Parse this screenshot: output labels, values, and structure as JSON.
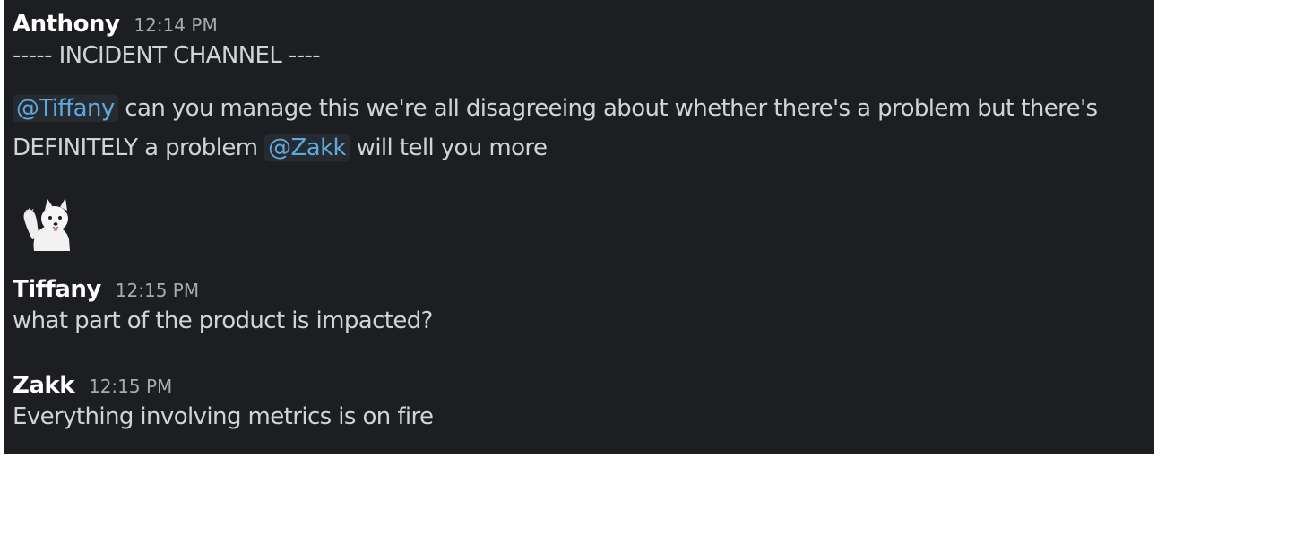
{
  "messages": [
    {
      "author": "Anthony",
      "time": "12:14 PM",
      "banner": "----- INCIDENT CHANNEL ----",
      "mention_1": "@Tiffany",
      "text_1": " can you manage this we're all disagreeing about whether there's a problem but there's",
      "text_2": "DEFINITELY a problem ",
      "mention_2": "@Zakk",
      "text_3": " will tell you more",
      "sticker": "waving-samoyed-icon"
    },
    {
      "author": "Tiffany",
      "time": "12:15 PM",
      "text": "what part of the product is impacted?"
    },
    {
      "author": "Zakk",
      "time": "12:15 PM",
      "text": "Everything involving metrics is on fire"
    }
  ],
  "colors": {
    "background": "#1d1e22",
    "mention": "#5fa9dc"
  }
}
